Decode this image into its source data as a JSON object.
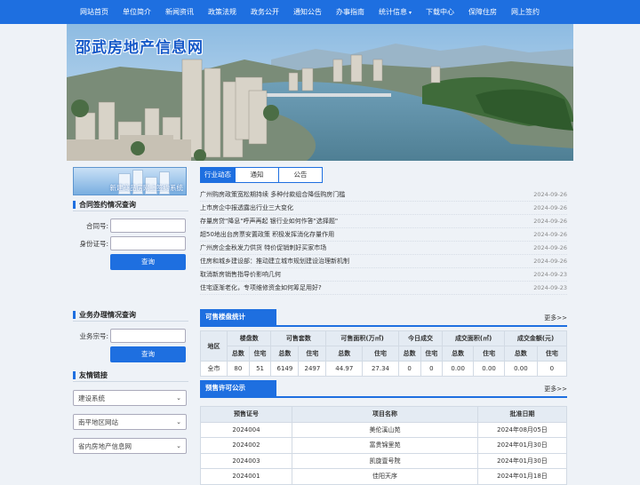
{
  "nav": [
    "网站首页",
    "单位简介",
    "新闻资讯",
    "政策法规",
    "政务公开",
    "通知公告",
    "办事指南",
    "统计信息",
    "下载中心",
    "保障住房",
    "网上签约"
  ],
  "nav_dropdown_caret": "▾",
  "banner": {
    "title": "邵武房地产信息网"
  },
  "promo": {
    "text": "新建商品房网上签约系统"
  },
  "contract_query": {
    "title": "合同签约情况查询",
    "contract_label": "合同号:",
    "id_label": "身份证号:",
    "button": "查询"
  },
  "business_query": {
    "title": "业务办理情况查询",
    "number_label": "业务宗号:",
    "button": "查询"
  },
  "links": {
    "title": "友情链接",
    "selects": [
      "建设系统",
      "南平地区网站",
      "省内房地产信息网"
    ]
  },
  "tabs": [
    "行业动态",
    "通知",
    "公告"
  ],
  "news": [
    {
      "title": "广州购房政策宽松期持续 多种付款组合降低购房门槛",
      "date": "2024-09-26"
    },
    {
      "title": "上市房企中报透露出行业三大变化",
      "date": "2024-09-26"
    },
    {
      "title": "存量房贷\"降息\"呼声再起 银行业如何作答\"选择题\"",
      "date": "2024-09-26"
    },
    {
      "title": "超50地出台房票安置政策 积极发挥消化存量作用",
      "date": "2024-09-26"
    },
    {
      "title": "广州房企金秋发力供货 特价促销刺好买家市场",
      "date": "2024-09-26"
    },
    {
      "title": "住房和城乡建设部：推动建立城市规划建设治理新机制",
      "date": "2024-09-26"
    },
    {
      "title": "取消新房销售指导价影响几何",
      "date": "2024-09-23"
    },
    {
      "title": "住宅逐渐老化，专项维修资金如何筹足用好?",
      "date": "2024-09-23"
    }
  ],
  "stats": {
    "title": "可售楼盘统计",
    "more": "更多>>",
    "area_header": "地区",
    "groups": [
      "楼盘数",
      "可售套数",
      "可售面积(万㎡)",
      "今日成交",
      "成交面积(㎡)",
      "成交金额(元)"
    ],
    "sub": [
      "总数",
      "住宅"
    ],
    "row": [
      "全市",
      "80",
      "51",
      "6149",
      "2497",
      "44.97",
      "27.34",
      "0",
      "0",
      "0.00",
      "0.00",
      "0.00",
      "0"
    ]
  },
  "presale": {
    "title": "预售许可公示",
    "more": "更多>>",
    "headers": [
      "预售证号",
      "项目名称",
      "批准日期"
    ],
    "rows": [
      [
        "2024004",
        "美伦溪山苑",
        "2024年08月05日"
      ],
      [
        "2024002",
        "富贵锦里苑",
        "2024年01月30日"
      ],
      [
        "2024003",
        "凯旋壹号院",
        "2024年01月30日"
      ],
      [
        "2024001",
        "佳阳天序",
        "2024年01月18日"
      ]
    ]
  },
  "colors": {
    "primary": "#1e6fe0",
    "header_bg": "#e4ebf3"
  }
}
